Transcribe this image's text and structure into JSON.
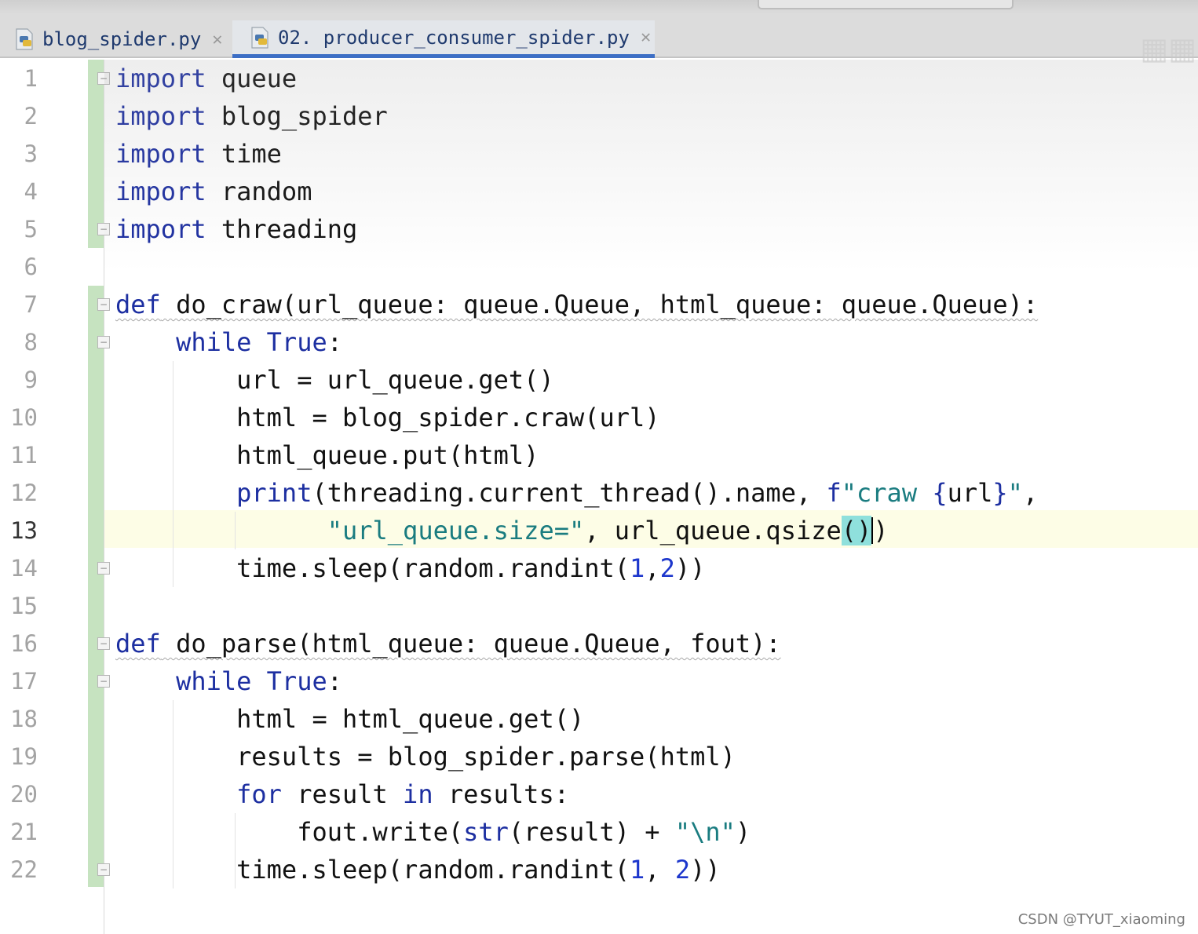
{
  "tabs": [
    {
      "label": "blog_spider.py",
      "active": false
    },
    {
      "label": "02. producer_consumer_spider.py",
      "active": true
    }
  ],
  "editor": {
    "current_line": 13,
    "line_numbers": [
      "1",
      "2",
      "3",
      "4",
      "5",
      "6",
      "7",
      "8",
      "9",
      "10",
      "11",
      "12",
      "13",
      "14",
      "15",
      "16",
      "17",
      "18",
      "19",
      "20",
      "21",
      "22"
    ]
  },
  "watermark": "CSDN @TYUT_xiaoming",
  "colors": {
    "keyword": "#1d2fa1",
    "string": "#1a7c80",
    "number": "#1c36cc",
    "vcs_added": "#c6e3c0",
    "current_line_bg": "#fdfde6",
    "brace_match": "#8fe0dc",
    "active_tab_underline": "#3c6ec5"
  },
  "icons": {
    "tab_file_icon": "python-file-icon",
    "tab_close": "close-icon",
    "fold": "fold-marker-icon"
  }
}
